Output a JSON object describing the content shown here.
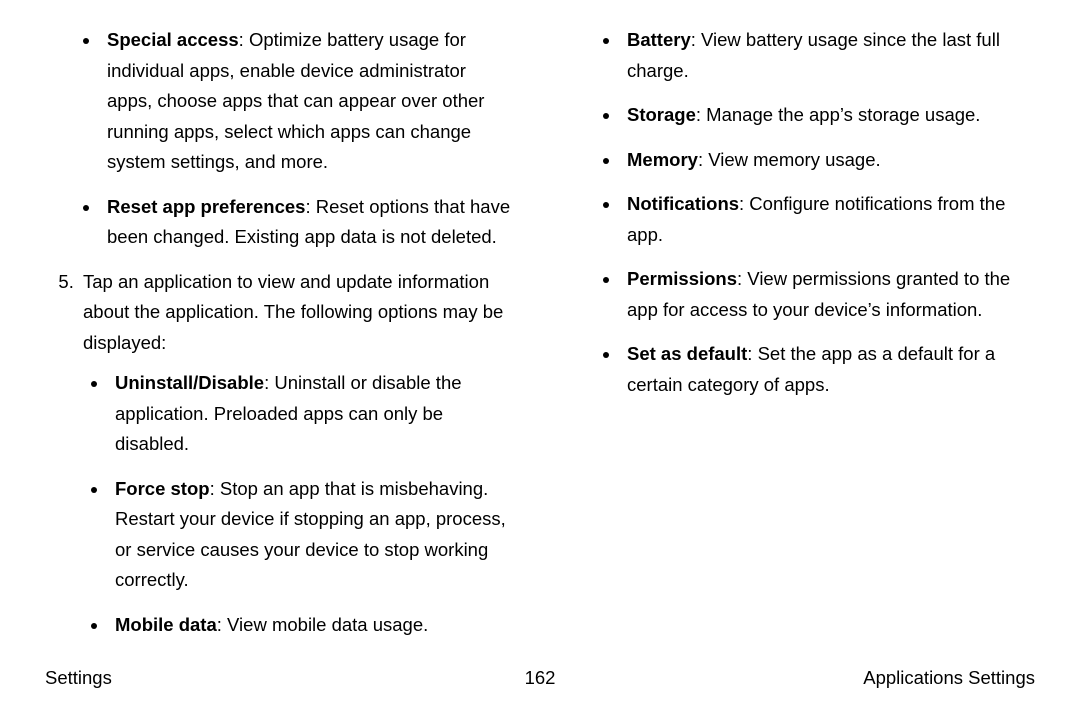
{
  "left": {
    "top_bullets": [
      {
        "label": "Special access",
        "text": ": Optimize battery usage for individual apps, enable device administrator apps, choose apps that can appear over other running apps, select which apps can change system settings, and more."
      },
      {
        "label": "Reset app preferences",
        "text": ": Reset options that have been changed. Existing app data is not deleted."
      }
    ],
    "step_number": "5",
    "step_text": "Tap an application to view and update information about the application. The following options may be displayed:",
    "step_bullets": [
      {
        "label": "Uninstall/Disable",
        "text": ": Uninstall or disable the application. Preloaded apps can only be disabled."
      },
      {
        "label": "Force stop",
        "text": ": Stop an app that is misbehaving. Restart your device if stopping an app, process, or service causes your device to stop working correctly."
      },
      {
        "label": "Mobile data",
        "text": ": View mobile data usage."
      }
    ]
  },
  "right": {
    "bullets": [
      {
        "label": "Battery",
        "text": ": View battery usage since the last full charge."
      },
      {
        "label": "Storage",
        "text": ": Manage the app’s storage usage."
      },
      {
        "label": "Memory",
        "text": ": View memory usage."
      },
      {
        "label": "Notifications",
        "text": ": Configure notifications from the app."
      },
      {
        "label": "Permissions",
        "text": ": View permissions granted to the app for access to your device’s information."
      },
      {
        "label": "Set as default",
        "text": ": Set the app as a default for a certain category of apps."
      }
    ]
  },
  "footer": {
    "left": "Settings",
    "center": "162",
    "right": "Applications Settings"
  }
}
